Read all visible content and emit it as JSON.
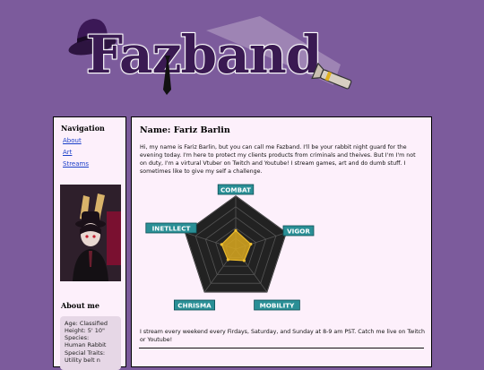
{
  "header": {
    "logo_text": "Fazband"
  },
  "sidebar": {
    "nav_title": "Navigation",
    "links": [
      "About",
      "Art",
      "Streams"
    ],
    "about_title": "About me",
    "about_lines": [
      "Age: Classified",
      "Height: 5' 10\"",
      "Species:",
      "Human Rabbit",
      "Special Traits:",
      "Utility belt n"
    ]
  },
  "main": {
    "name_heading": "Name: Fariz Barlin",
    "intro": "Hi, my name is Fariz Barlin, but you can call me Fazband. I'll be your rabbit night guard for the evening today. I'm here to protect my clients products from criminals and theives. But I'm I'm not on duty, I'm a virtural Vtuber on Twitch and Youtube! I stream games, art and do dumb stuff. I sometimes like to give my self a challenge.",
    "outro": "I stream every weekend every Firdays, Saturday, and Sunday at 8-9 am PST. Catch me live on Twitch or Youtube!"
  },
  "chart_data": {
    "type": "radar",
    "categories": [
      "COMBAT",
      "VIGOR",
      "MOBILITY",
      "CHRISMA",
      "INETLLECT"
    ],
    "values": [
      0.35,
      0.3,
      0.27,
      0.25,
      0.28
    ],
    "max": 1,
    "rings": 5,
    "colors": {
      "fill": "#d9a81e",
      "grid": "#3a3a3a",
      "bg": "#222222",
      "label_bg": "#2a8f96"
    }
  },
  "colors": {
    "page_bg": "#7c5b9c",
    "panel_bg": "#fdf0fb",
    "link": "#1a3fc9"
  }
}
